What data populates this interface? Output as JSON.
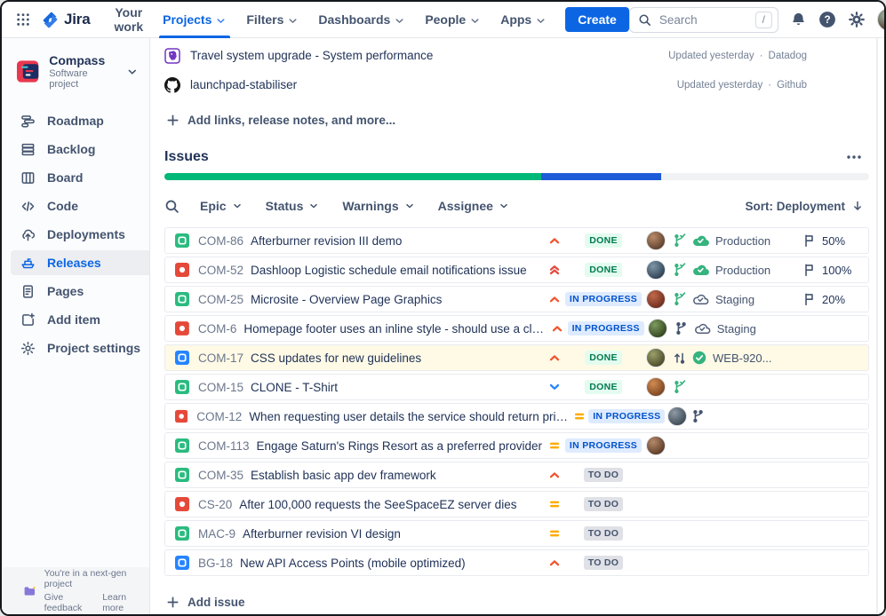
{
  "colors": {
    "accent": "#0c66e4",
    "story": "#2abb7f",
    "bug": "#e5493a",
    "task": "#2684ff",
    "prio_highest": "#e2483d",
    "prio_high": "#f1542f",
    "prio_medium": "#ffab00",
    "prio_low": "#2684ff",
    "badge_done_bg": "#e3fcef",
    "badge_done_fg": "#007a50",
    "badge_inprogress_bg": "#deebff",
    "badge_inprogress_fg": "#0052cc",
    "badge_todo_bg": "#dfe1e6",
    "badge_todo_fg": "#44546f",
    "env_green": "#36b37e",
    "env_outline": "#505f79",
    "branch_green": "#36b37e",
    "branch_navy": "#44546f",
    "icon_gray": "#44546f",
    "highlight_row": "#fffae6"
  },
  "navbar": {
    "items": [
      {
        "label": "Your work"
      },
      {
        "label": "Projects"
      },
      {
        "label": "Filters"
      },
      {
        "label": "Dashboards"
      },
      {
        "label": "People"
      },
      {
        "label": "Apps"
      }
    ],
    "create_label": "Create",
    "search_placeholder": "Search",
    "search_shortcut": "/"
  },
  "sidebar": {
    "project": {
      "name": "Compass",
      "type": "Software project"
    },
    "items": [
      {
        "label": "Roadmap"
      },
      {
        "label": "Backlog"
      },
      {
        "label": "Board"
      },
      {
        "label": "Code"
      },
      {
        "label": "Deployments"
      },
      {
        "label": "Releases"
      },
      {
        "label": "Pages"
      },
      {
        "label": "Add item"
      },
      {
        "label": "Project settings"
      }
    ],
    "footer": {
      "line1": "You're in a next-gen project",
      "feedback_label": "Give feedback",
      "learn_label": "Learn more"
    }
  },
  "main": {
    "dot": "·",
    "linked_items": [
      {
        "icon": "datadog",
        "title": "Travel system upgrade - System performance",
        "updated": "Updated yesterday",
        "source": "Datadog"
      },
      {
        "icon": "github",
        "title": "launchpad-stabiliser",
        "updated": "Updated yesterday",
        "source": "Github"
      }
    ],
    "add_links_label": "Add links, release notes, and more...",
    "issues": {
      "title": "Issues",
      "progress": {
        "done_pct": 53.5,
        "in_progress_pct": 17,
        "done_color": "#00b877",
        "in_progress_color": "#1d5bd8",
        "track_color": "#f1f2f4"
      },
      "filters": [
        {
          "label": "Epic"
        },
        {
          "label": "Status"
        },
        {
          "label": "Warnings"
        },
        {
          "label": "Assignee"
        }
      ],
      "sort_label": "Sort: Deployment",
      "add_issue_label": "Add issue",
      "rows": [
        {
          "key": "COM-86",
          "type": "story",
          "title": "Afterburner revision III demo",
          "priority": "high",
          "status": "DONE",
          "avatar": [
            "#b98b6a",
            "#5d3f2c"
          ],
          "branch": "green",
          "env": {
            "type": "production",
            "label": "Production"
          },
          "flag": "50%"
        },
        {
          "key": "COM-52",
          "type": "bug",
          "title": "Dashloop Logistic schedule email notifications issue",
          "priority": "highest",
          "status": "DONE",
          "avatar": [
            "#7e98a8",
            "#2e3f52"
          ],
          "branch": "green",
          "env": {
            "type": "production",
            "label": "Production"
          },
          "flag": "100%"
        },
        {
          "key": "COM-25",
          "type": "story",
          "title": "Microsite - Overview Page Graphics",
          "priority": "high",
          "status": "IN PROGRESS",
          "avatar": [
            "#c06a4a",
            "#6e2c1e"
          ],
          "branch": "green",
          "env": {
            "type": "staging",
            "label": "Staging"
          },
          "flag": "20%"
        },
        {
          "key": "COM-6",
          "type": "bug",
          "title": "Homepage footer uses an inline style - should use a class",
          "priority": "high",
          "status": "IN PROGRESS",
          "avatar": [
            "#7d9a5f",
            "#32451f"
          ],
          "branch": "navy",
          "env": {
            "type": "staging",
            "label": "Staging"
          },
          "flag": null
        },
        {
          "key": "COM-17",
          "type": "task",
          "title": "CSS updates for new guidelines",
          "priority": "high",
          "status": "DONE",
          "avatar": [
            "#9aa06a",
            "#4c4a28"
          ],
          "branch": "navy-up",
          "env": {
            "type": "release",
            "label": "WEB-920..."
          },
          "flag": null,
          "highlighted": true
        },
        {
          "key": "COM-15",
          "type": "story",
          "title": "CLONE - T-Shirt",
          "priority": "low",
          "status": "DONE",
          "avatar": [
            "#d28b52",
            "#7a4420"
          ],
          "branch": "green",
          "env": null,
          "flag": null
        },
        {
          "key": "COM-12",
          "type": "bug",
          "title": "When requesting user details the service should return prior trip info",
          "priority": "medium",
          "status": "IN PROGRESS",
          "avatar": [
            "#8e9aa5",
            "#3c4a55"
          ],
          "branch": "navy",
          "env": null,
          "flag": null
        },
        {
          "key": "COM-113",
          "type": "story",
          "title": "Engage Saturn's Rings Resort as a preferred provider",
          "priority": "medium",
          "status": "IN PROGRESS",
          "avatar": [
            "#b58a6b",
            "#5a3a26"
          ],
          "branch": null,
          "env": null,
          "flag": null
        },
        {
          "key": "COM-35",
          "type": "story",
          "title": "Establish basic app dev framework",
          "priority": "high",
          "status": "TO DO",
          "avatar": null,
          "branch": null,
          "env": null,
          "flag": null
        },
        {
          "key": "CS-20",
          "type": "bug",
          "title": "After 100,000 requests the SeeSpaceEZ server dies",
          "priority": "medium",
          "status": "TO DO",
          "avatar": null,
          "branch": null,
          "env": null,
          "flag": null
        },
        {
          "key": "MAC-9",
          "type": "story",
          "title": "Afterburner revision VI design",
          "priority": "medium",
          "status": "TO DO",
          "avatar": null,
          "branch": null,
          "env": null,
          "flag": null
        },
        {
          "key": "BG-18",
          "type": "task",
          "title": "New API Access Points (mobile optimized)",
          "priority": "high",
          "status": "TO DO",
          "avatar": null,
          "branch": null,
          "env": null,
          "flag": null
        }
      ]
    }
  }
}
